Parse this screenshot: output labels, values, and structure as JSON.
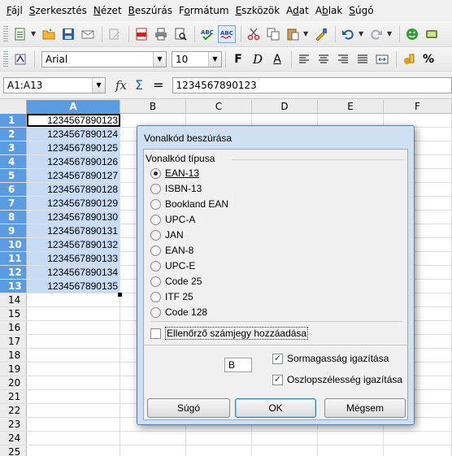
{
  "menubar": {
    "items": [
      {
        "label": "Fájl",
        "u": 0
      },
      {
        "label": "Szerkesztés",
        "u": 0
      },
      {
        "label": "Nézet",
        "u": 0
      },
      {
        "label": "Beszúrás",
        "u": 0
      },
      {
        "label": "Formátum",
        "u": 1
      },
      {
        "label": "Eszközök",
        "u": 0
      },
      {
        "label": "Adat",
        "u": 1
      },
      {
        "label": "Ablak",
        "u": 1
      },
      {
        "label": "Súgó",
        "u": 0
      }
    ]
  },
  "format_toolbar": {
    "font_name": "Arial",
    "font_size": "10",
    "bold": "F",
    "italic": "D",
    "underline": "A"
  },
  "formula_bar": {
    "name_box": "A1:A13",
    "fx": "fx",
    "sigma": "Σ",
    "equals": "=",
    "content": "1234567890123"
  },
  "sheet": {
    "columns": [
      "A",
      "B",
      "C",
      "D",
      "E",
      "F"
    ],
    "rows": [
      "1",
      "2",
      "3",
      "4",
      "5",
      "6",
      "7",
      "8",
      "9",
      "10",
      "11",
      "12",
      "13",
      "14",
      "15",
      "16",
      "17",
      "18",
      "19",
      "20",
      "21",
      "22",
      "23",
      "24",
      "25"
    ],
    "column_a": [
      "1234567890123",
      "1234567890124",
      "1234567890125",
      "1234567890126",
      "1234567890127",
      "1234567890128",
      "1234567890129",
      "1234567890130",
      "1234567890131",
      "1234567890132",
      "1234567890133",
      "1234567890134",
      "1234567890135"
    ],
    "selected_column": "A",
    "selected_rows": 13
  },
  "dialog": {
    "title": "Vonalkód beszúrása",
    "group_label": "Vonalkód típusa",
    "options": [
      {
        "label": "EAN-13",
        "checked": true
      },
      {
        "label": "ISBN-13",
        "checked": false
      },
      {
        "label": "Bookland EAN",
        "checked": false
      },
      {
        "label": "UPC-A",
        "checked": false
      },
      {
        "label": "JAN",
        "checked": false
      },
      {
        "label": "EAN-8",
        "checked": false
      },
      {
        "label": "UPC-E",
        "checked": false
      },
      {
        "label": "Code 25",
        "checked": false
      },
      {
        "label": "ITF 25",
        "checked": false
      },
      {
        "label": "Code 128",
        "checked": false
      }
    ],
    "checksum_label": "Ellenőrző számjegy hozzáadása",
    "checksum_checked": false,
    "column_input": "B",
    "row_height_label": "Sormagasság igazítása",
    "row_height_checked": true,
    "col_width_label": "Oszlopszélesség igazítása",
    "col_width_checked": true,
    "buttons": {
      "help": "Súgó",
      "ok": "OK",
      "cancel": "Mégsem"
    }
  }
}
